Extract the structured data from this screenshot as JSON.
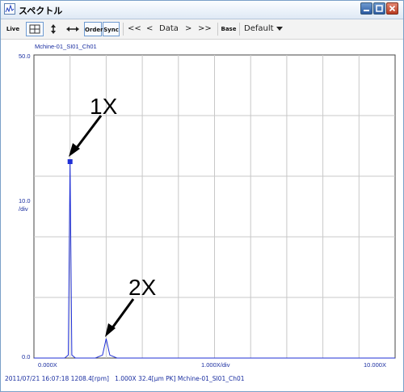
{
  "window": {
    "title": "スペクトル"
  },
  "toolbar": {
    "live": "Live",
    "order": "Order",
    "sync": "Sync",
    "nav_first": "<<",
    "nav_prev": "<",
    "data_label": "Data",
    "nav_next": ">",
    "nav_last": ">>",
    "base": "Base",
    "preset": "Default"
  },
  "chart": {
    "channel_label": "Mchine-01_SI01_Ch01",
    "y_top": "50.0",
    "y_div": "10.0",
    "y_div_unit": "/div",
    "y_bottom": "0.0",
    "x_left": "0.000X",
    "x_mid": "1.000X/div",
    "x_right": "10.000X",
    "annotation_1x": "1X",
    "annotation_2x": "2X",
    "colors": {
      "trace": "#1f2fd6",
      "grid": "#c8c8c8",
      "label": "#1a2ea0"
    }
  },
  "chart_data": {
    "type": "line",
    "xlim": [
      0,
      10
    ],
    "ylim": [
      0,
      50
    ],
    "xlabel": "",
    "ylabel": "",
    "x": [
      0,
      0.5,
      0.85,
      0.95,
      1.0,
      1.05,
      1.15,
      1.7,
      1.9,
      2.0,
      2.1,
      2.3,
      10
    ],
    "series": [
      {
        "values": [
          0,
          0,
          0,
          0.5,
          32.4,
          0.5,
          0,
          0,
          0.5,
          3.2,
          0.5,
          0,
          0
        ]
      }
    ],
    "peak_marker": {
      "x": 1.0,
      "y": 32.4
    }
  },
  "status": {
    "text": "2011/07/21 16:07:18 1208.4[rpm]   1.000X 32.4[μm PK] Mchine-01_SI01_Ch01"
  }
}
